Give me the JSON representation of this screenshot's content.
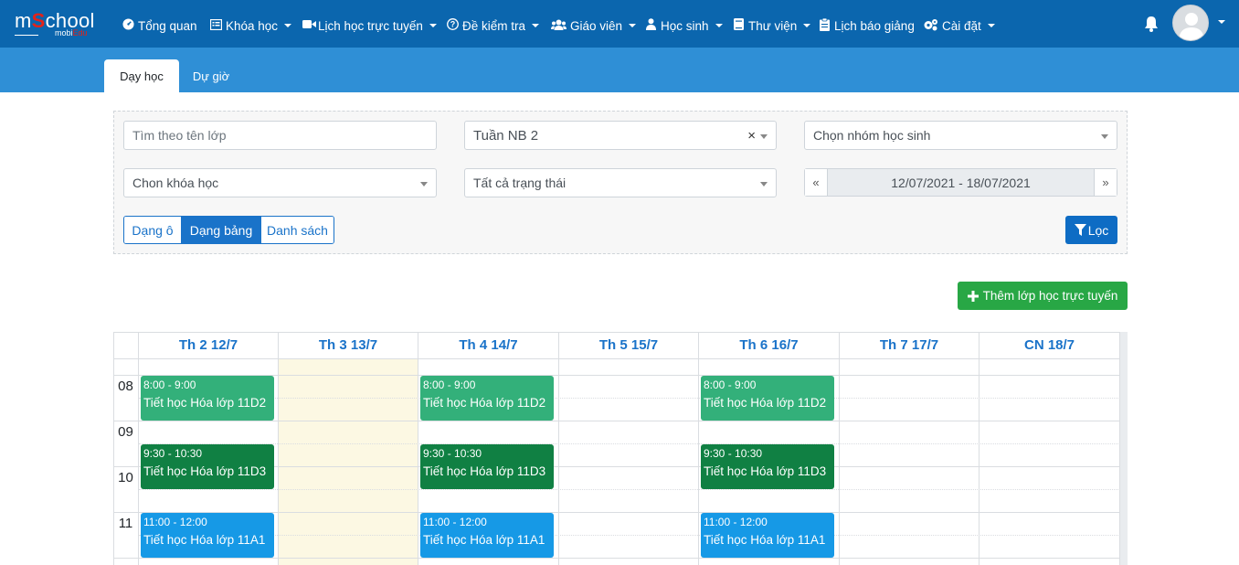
{
  "app": {
    "logo_prefix": "m",
    "logo_o": "S",
    "logo_rest": "chool",
    "logo_sub": "mobi",
    "logo_sub_accent": "Edu"
  },
  "nav": {
    "items": [
      {
        "label": "Tổng quan",
        "icon": "dashboard-icon"
      },
      {
        "label": "Khóa học",
        "icon": "list-icon"
      },
      {
        "label": "Lịch học trực tuyến",
        "icon": "video-icon"
      },
      {
        "label": "Đề kiểm tra",
        "icon": "question-icon"
      },
      {
        "label": "Giáo viên",
        "icon": "users-icon"
      },
      {
        "label": "Học sinh",
        "icon": "user-icon"
      },
      {
        "label": "Thư viện",
        "icon": "book-icon"
      },
      {
        "label": "Lịch báo giảng",
        "icon": "clipboard-icon"
      },
      {
        "label": "Cài đặt",
        "icon": "cogs-icon"
      }
    ]
  },
  "tabs": {
    "active": "Dạy học",
    "inactive": "Dự giờ"
  },
  "filters": {
    "search_placeholder": "Tìm theo tên lớp",
    "week_value": "Tuần NB 2",
    "group_placeholder": "Chọn nhóm học sinh",
    "course_placeholder": "Chon khóa học",
    "status_value": "Tất cả trạng thái",
    "date_range": "12/07/2021 - 18/07/2021",
    "prev": "«",
    "next": "»",
    "clear": "×"
  },
  "views": {
    "grid": "Dạng ô",
    "table": "Dạng bảng",
    "list": "Danh sách"
  },
  "buttons": {
    "filter": "Lọc",
    "add_online": "Thêm lớp học trực tuyến"
  },
  "calendar": {
    "days": [
      "Th 2 12/7",
      "Th 3 13/7",
      "Th 4 14/7",
      "Th 5 15/7",
      "Th 6 16/7",
      "Th 7 17/7",
      "CN 18/7"
    ],
    "hours": [
      "08",
      "09",
      "10",
      "11"
    ],
    "events": [
      {
        "day": 0,
        "start": "8:00",
        "time": "8:00 - 9:00",
        "name": "Tiết học Hóa lớp 11D2",
        "color": "#33b07a"
      },
      {
        "day": 2,
        "start": "8:00",
        "time": "8:00 - 9:00",
        "name": "Tiết học Hóa lớp 11D2",
        "color": "#33b07a"
      },
      {
        "day": 4,
        "start": "8:00",
        "time": "8:00 - 9:00",
        "name": "Tiết học Hóa lớp 11D2",
        "color": "#33b07a"
      },
      {
        "day": 0,
        "start": "9:30",
        "time": "9:30 - 10:30",
        "name": "Tiết học Hóa lớp 11D3",
        "color": "#108043"
      },
      {
        "day": 2,
        "start": "9:30",
        "time": "9:30 - 10:30",
        "name": "Tiết học Hóa lớp 11D3",
        "color": "#108043"
      },
      {
        "day": 4,
        "start": "9:30",
        "time": "9:30 - 10:30",
        "name": "Tiết học Hóa lớp 11D3",
        "color": "#108043"
      },
      {
        "day": 0,
        "start": "11:00",
        "time": "11:00 - 12:00",
        "name": "Tiết học Hóa lớp 11A1",
        "color": "#1699e6"
      },
      {
        "day": 2,
        "start": "11:00",
        "time": "11:00 - 12:00",
        "name": "Tiết học Hóa lớp 11A1",
        "color": "#1699e6"
      },
      {
        "day": 4,
        "start": "11:00",
        "time": "11:00 - 12:00",
        "name": "Tiết học Hóa lớp 11A1",
        "color": "#1699e6"
      }
    ]
  }
}
